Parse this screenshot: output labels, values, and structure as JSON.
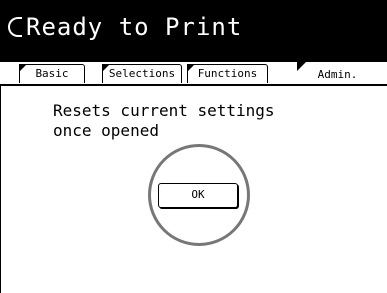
{
  "header": {
    "status_icon": "partial-circle-icon",
    "status_text": "Ready to Print"
  },
  "tabs": [
    {
      "label": "Basic",
      "active": false
    },
    {
      "label": "Selections",
      "active": false
    },
    {
      "label": "Functions",
      "active": false
    },
    {
      "label": "Admin.",
      "active": true
    }
  ],
  "dialog": {
    "message": "Resets current settings\nonce opened",
    "ok_label": "OK"
  }
}
